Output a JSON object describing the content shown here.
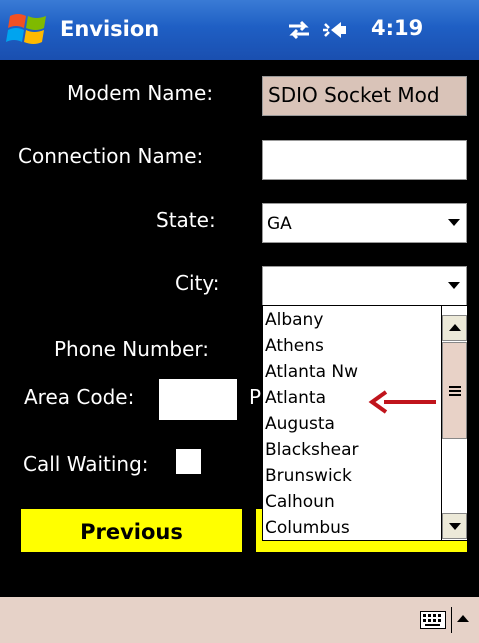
{
  "app": {
    "title": "Envision"
  },
  "status": {
    "time": "4:19",
    "connectivity_icon": "connectivity-icon",
    "volume_icon": "volume-icon"
  },
  "form": {
    "modem_name_label": "Modem Name:",
    "modem_name_value": "SDIO Socket Mod",
    "connection_name_label": "Connection Name:",
    "connection_name_value": "",
    "state_label": "State:",
    "state_value": "GA",
    "city_label": "City:",
    "city_value": "",
    "phone_number_label": "Phone Number:",
    "area_code_label": "Area Code:",
    "area_code_value": "",
    "partial_label": "P",
    "call_waiting_label": "Call Waiting:",
    "call_waiting_checked": false
  },
  "city_dropdown": {
    "options": [
      "Albany",
      "Athens",
      "Atlanta Nw",
      "Atlanta",
      "Augusta",
      "Blackshear",
      "Brunswick",
      "Calhoun",
      "Columbus"
    ],
    "annotated_option": "Atlanta",
    "annotation_color": "#c0141c"
  },
  "buttons": {
    "previous": "Previous",
    "next": ""
  },
  "colors": {
    "title_bar": "#1f5fc4",
    "button": "#ffff00",
    "menu_bar": "#e6d2c8",
    "readonly_field": "#d9c3b8"
  },
  "menubar": {
    "keyboard_icon": "keyboard-icon"
  }
}
